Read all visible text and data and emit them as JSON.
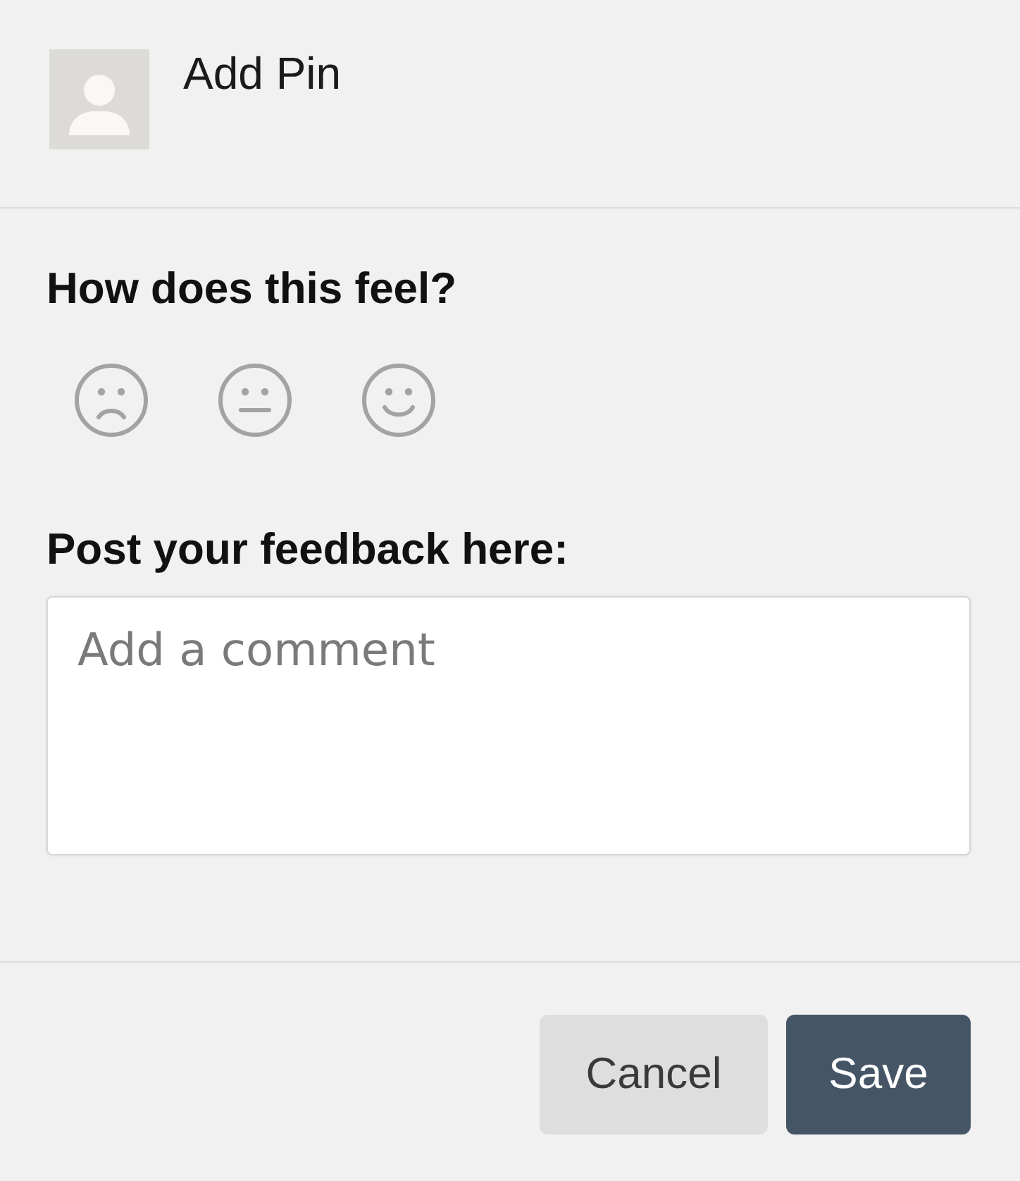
{
  "header": {
    "title": "Add Pin"
  },
  "rating": {
    "question": "How does this feel?",
    "faces": [
      {
        "kind": "sad"
      },
      {
        "kind": "neutral"
      },
      {
        "kind": "happy"
      }
    ]
  },
  "feedback": {
    "label": "Post your feedback here:",
    "placeholder": "Add a comment"
  },
  "buttons": [
    {
      "label": "Cancel",
      "kind": "secondary"
    },
    {
      "label": "Save",
      "kind": "primary"
    }
  ]
}
